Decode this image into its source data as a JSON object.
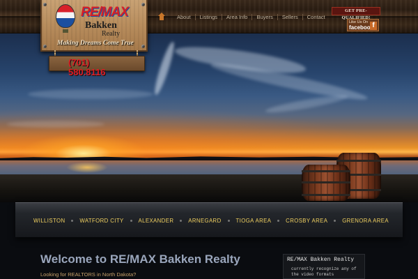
{
  "brand": {
    "remax": "RE/MAX",
    "bakken": "Bakken",
    "realty": "Realty",
    "tagline": "Making Dreams Come True",
    "phone_line1": "(701)",
    "phone_line2": "580.8116"
  },
  "nav": {
    "items": [
      "About",
      "Listings",
      "Area Info",
      "Buyers",
      "Sellers",
      "Contact"
    ]
  },
  "prequalified_label": "GET PRE-QUALIFIED!",
  "facebook": {
    "small": "Like Us On",
    "word": "facebook",
    "icon": "f"
  },
  "areas": [
    "WILLISTON",
    "WATFORD CITY",
    "ALEXANDER",
    "ARNEGARD",
    "TIOGA AREA",
    "CROSBY AREA",
    "GRENORA AREA"
  ],
  "main": {
    "welcome": "Welcome to RE/MAX Bakken Realty",
    "question": "Looking for REALTORS in North Dakota?"
  },
  "video": {
    "title": "RE/MAX Bakken Realty",
    "message": "currently recognize any of the video formats"
  },
  "colors": {
    "accent_gold": "#f0d060",
    "remax_red": "#d61f26",
    "wood": "#b88d5d"
  }
}
